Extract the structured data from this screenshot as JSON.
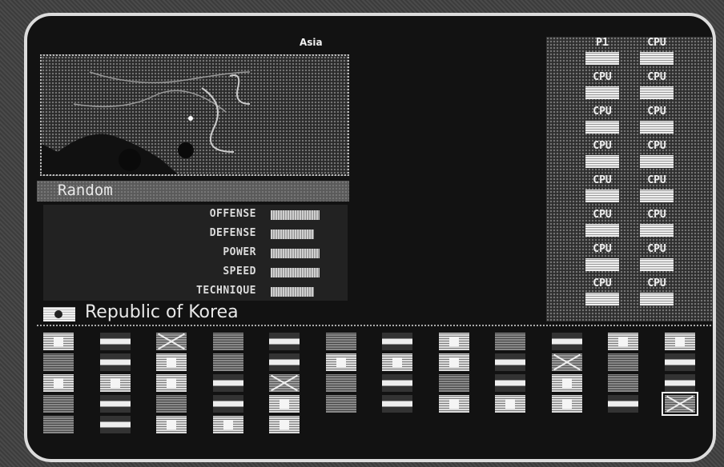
{
  "region": "Asia",
  "team": {
    "name": "Random",
    "country": "Republic of Korea"
  },
  "stats": [
    {
      "label": "OFFENSE",
      "level": 0.95
    },
    {
      "label": "DEFENSE",
      "level": 0.85
    },
    {
      "label": "POWER",
      "level": 0.95
    },
    {
      "label": "SPEED",
      "level": 0.95
    },
    {
      "label": "TECHNIQUE",
      "level": 0.85
    }
  ],
  "selection": {
    "left": [
      "P1",
      "CPU",
      "CPU",
      "CPU",
      "CPU",
      "CPU",
      "CPU",
      "CPU"
    ],
    "right": [
      "CPU",
      "CPU",
      "CPU",
      "CPU",
      "CPU",
      "CPU",
      "CPU",
      "CPU"
    ]
  },
  "flag_grid": {
    "rows": 5,
    "cols": 12,
    "last_row_count": 5
  }
}
